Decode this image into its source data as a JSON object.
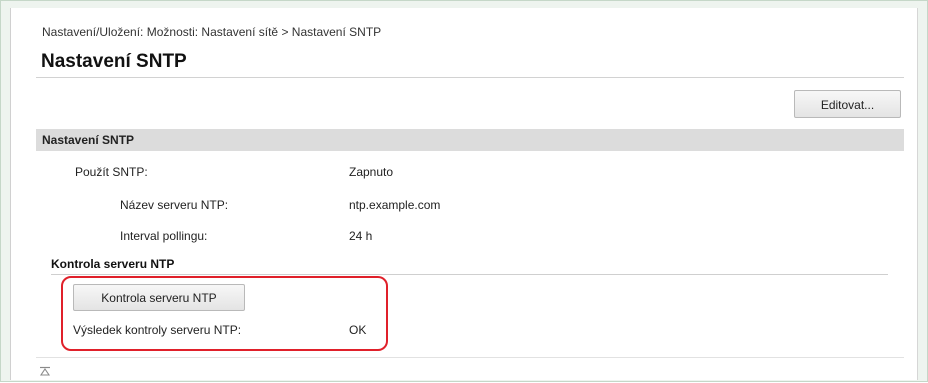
{
  "breadcrumb": "Nastavení/Uložení: Možnosti: Nastavení sítě > Nastavení SNTP",
  "page_title": "Nastavení SNTP",
  "toolbar": {
    "edit_label": "Editovat..."
  },
  "section": {
    "header": "Nastavení SNTP",
    "rows": [
      {
        "label": "Použít SNTP:",
        "value": "Zapnuto"
      },
      {
        "label": "Název serveru NTP:",
        "value": "ntp.example.com"
      },
      {
        "label": "Interval pollingu:",
        "value": "24 h"
      }
    ]
  },
  "check": {
    "header": "Kontrola serveru NTP",
    "button_label": "Kontrola serveru NTP",
    "result_label": "Výsledek kontroly serveru NTP:",
    "result_value": "OK"
  },
  "colors": {
    "highlight": "#e0202a",
    "section_bg": "#dcdcdc"
  },
  "icons": {
    "scroll_top": "scroll-to-top-icon"
  }
}
